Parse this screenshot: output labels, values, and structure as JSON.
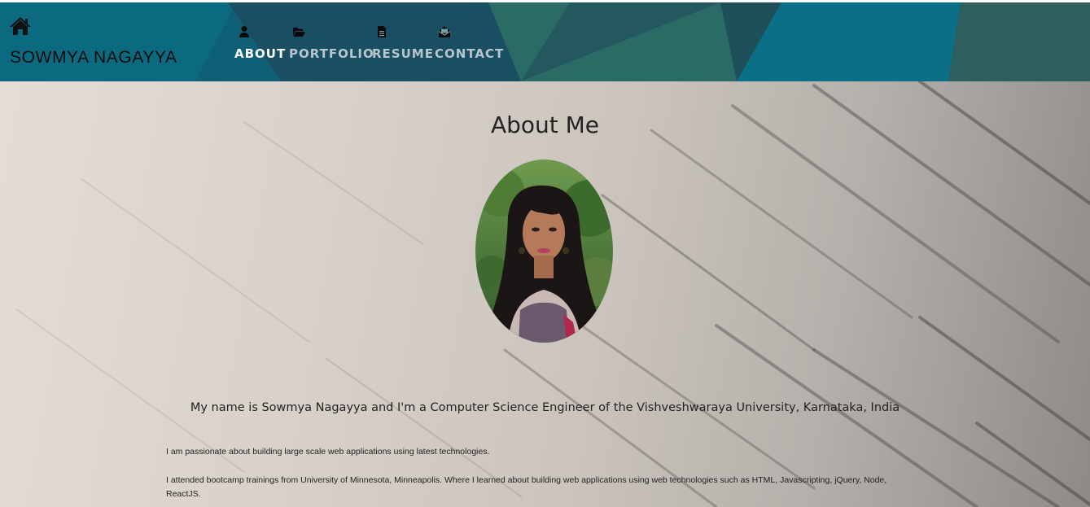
{
  "brand": {
    "name": "SOWMYA NAGAYYA",
    "icon": "home-icon"
  },
  "nav": {
    "items": [
      {
        "label": "ABOUT",
        "icon": "user-icon",
        "active": true
      },
      {
        "label": "PORTFOLIO",
        "icon": "folder-open-icon",
        "active": false
      },
      {
        "label": "RESUME",
        "icon": "file-icon",
        "active": false
      },
      {
        "label": "CONTACT",
        "icon": "envelope-open-icon",
        "active": false
      }
    ]
  },
  "about": {
    "title": "About Me",
    "lead": "My name is Sowmya Nagayya and I'm a Computer Science Engineer of the Vishveshwaraya University, Karnataka, India",
    "paragraphs": [
      "I am passionate about building large scale web applications using latest technologies.",
      "I attended bootcamp trainings from University of Minnesota, Minneapolis. Where I learned about building web applications using web technologies such as HTML, Javascripting, jQuery, Node, ReactJS."
    ]
  },
  "colors": {
    "header_teal": "#0f5f76",
    "header_dark": "#1e4a5c",
    "header_green": "#2b6e67",
    "nav_active": "#ffffff",
    "nav_inactive": "#b6c6cc"
  }
}
